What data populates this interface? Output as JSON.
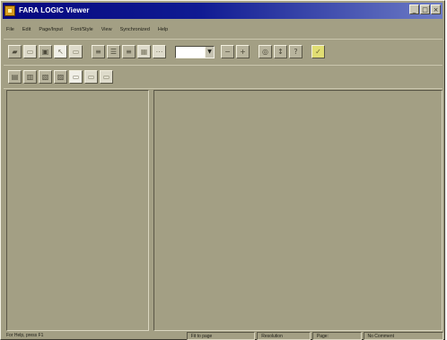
{
  "window": {
    "title": "FARA LOGIC Viewer",
    "controls": [
      "_",
      "□",
      "×"
    ]
  },
  "menu": {
    "items": [
      "File",
      "Edit",
      "Page/Input",
      "Font/Style",
      "View",
      "Synchronized",
      "Help"
    ]
  },
  "toolbar1": {
    "buttons": [
      {
        "name": "open-icon",
        "glyph": "▰",
        "style": "normal"
      },
      {
        "name": "save-icon",
        "glyph": "▭",
        "style": "light"
      },
      {
        "name": "print-icon",
        "glyph": "▣",
        "style": "normal"
      },
      {
        "name": "cursor-icon",
        "glyph": "↖",
        "style": "active"
      },
      {
        "name": "select-icon",
        "glyph": "▭",
        "style": "light"
      },
      {
        "name": "align-left-icon",
        "glyph": "≡",
        "style": "normal"
      },
      {
        "name": "align-center-icon",
        "glyph": "☰",
        "style": "normal"
      },
      {
        "name": "align-right-icon",
        "glyph": "≡",
        "style": "normal"
      },
      {
        "name": "grid-icon",
        "glyph": "▦",
        "style": "light"
      },
      {
        "name": "pattern-icon",
        "glyph": "⋯",
        "style": "light"
      },
      {
        "name": "zoom-out-icon",
        "glyph": "−",
        "style": "normal"
      },
      {
        "name": "zoom-in-icon",
        "glyph": "+",
        "style": "normal"
      },
      {
        "name": "find-icon",
        "glyph": "◎",
        "style": "normal"
      },
      {
        "name": "transform-icon",
        "glyph": "↕",
        "style": "normal"
      },
      {
        "name": "help-icon",
        "glyph": "?",
        "style": "normal"
      },
      {
        "name": "check-icon",
        "glyph": "✓",
        "style": "yellow"
      }
    ],
    "combo_value": ""
  },
  "toolbar2": {
    "buttons": [
      {
        "name": "mode-1-icon",
        "glyph": "▤",
        "style": "normal"
      },
      {
        "name": "mode-2-icon",
        "glyph": "▥",
        "style": "normal"
      },
      {
        "name": "mode-3-icon",
        "glyph": "▧",
        "style": "normal"
      },
      {
        "name": "mode-4-icon",
        "glyph": "▨",
        "style": "normal"
      },
      {
        "name": "mode-5-icon",
        "glyph": "▭",
        "style": "active"
      },
      {
        "name": "mode-6-icon",
        "glyph": "▭",
        "style": "light"
      },
      {
        "name": "mode-7-icon",
        "glyph": "▭",
        "style": "light"
      }
    ]
  },
  "statusbar": {
    "left_text": "For Help, press F1",
    "cells": [
      "Fit to page",
      "Resolution",
      "Page:",
      "No Comment"
    ]
  }
}
